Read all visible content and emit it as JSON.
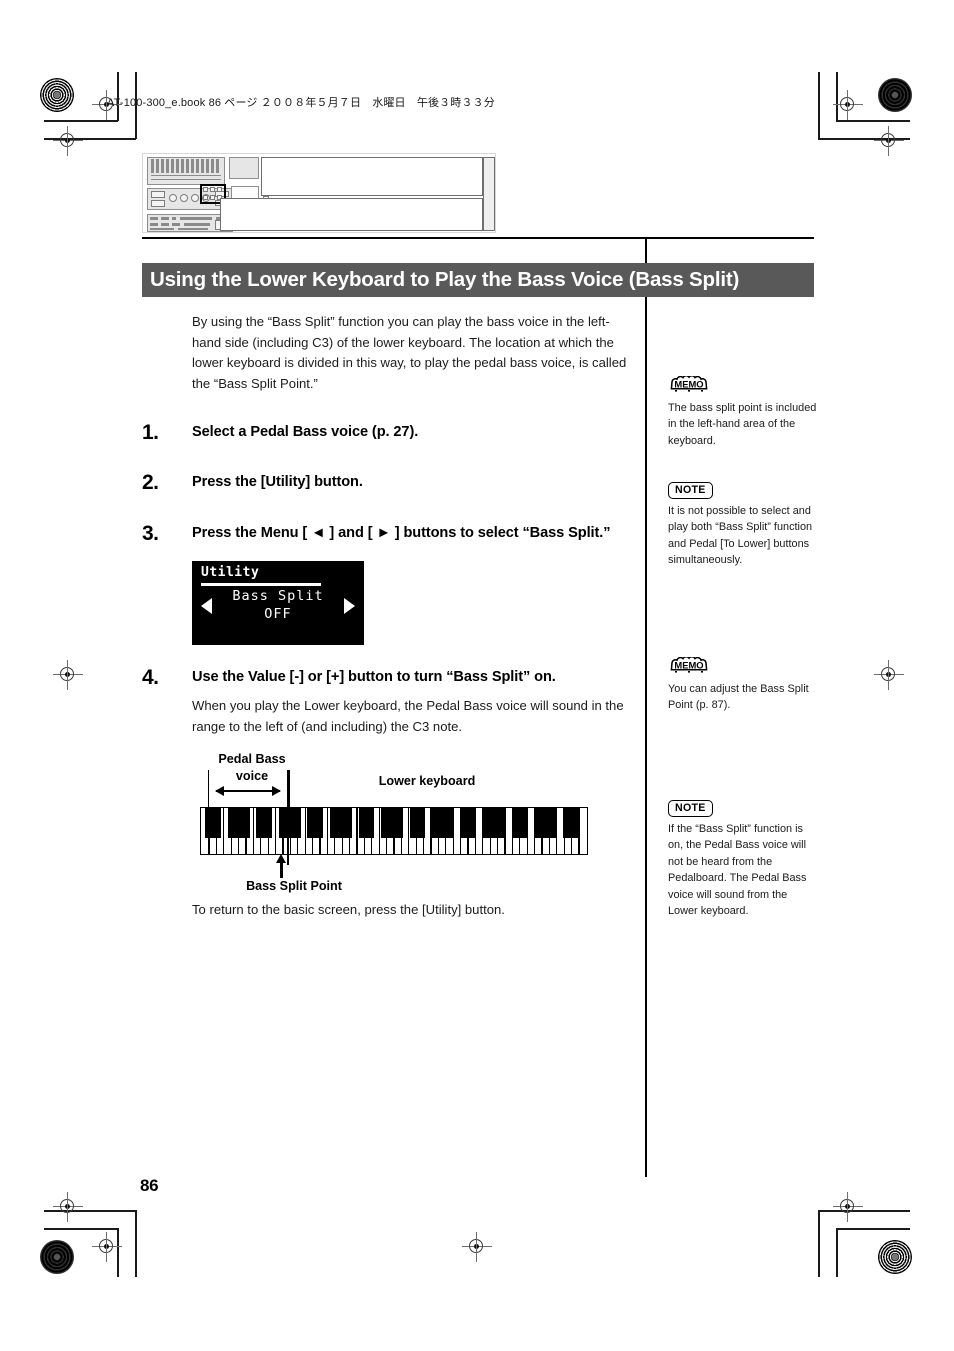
{
  "document": {
    "file_header": "AT-100-300_e.book  86 ページ  ２００８年５月７日　水曜日　午後３時３３分",
    "page_number": "86"
  },
  "section": {
    "title": "Using the Lower Keyboard to Play the Bass Voice (Bass Split)",
    "banner_color": "#595959",
    "intro": "By using the “Bass Split” function you can play the bass voice in the left-hand side (including C3) of the lower keyboard. The location at which the lower keyboard is divided in this way, to play the pedal bass voice, is called the “Bass Split Point.”"
  },
  "steps": [
    {
      "num": "1.",
      "text": "Select a Pedal Bass voice (p. 27)."
    },
    {
      "num": "2.",
      "text": "Press the [Utility] button."
    },
    {
      "num": "3.",
      "text": "Press the Menu [ ◄ ] and [ ► ] buttons to select “Bass Split.”"
    },
    {
      "num": "4.",
      "text": "Use the Value [-] or [+] button to turn “Bass Split” on.",
      "sub": "When you play the Lower keyboard, the Pedal Bass voice will sound in the range to the left of (and including) the C3 note."
    }
  ],
  "lcd": {
    "title": "Utility",
    "line1": "Bass Split",
    "line2": "OFF",
    "arrow_left": "left-triangle",
    "arrow_right": "right-triangle"
  },
  "diagram": {
    "label_pedal_bass_line1": "Pedal Bass",
    "label_pedal_bass_line2": "voice",
    "label_lower_keyboard": "Lower keyboard",
    "label_split_point": "Bass Split Point"
  },
  "closing_text": "To return to the basic screen, press the [Utility] button.",
  "sidebar": [
    {
      "type": "MEMO",
      "badge": "MEMO",
      "text": "The bass split point is included in the left-hand area of the keyboard."
    },
    {
      "type": "NOTE",
      "badge": "NOTE",
      "text": "It is not possible to select and play both “Bass Split” function and Pedal [To Lower] buttons simultaneously."
    },
    {
      "type": "MEMO",
      "badge": "MEMO",
      "text": "You can adjust the Bass Split Point (p. 87)."
    },
    {
      "type": "NOTE",
      "badge": "NOTE",
      "text": "If the “Bass Split” function is on, the Pedal Bass voice will not be heard from the Pedalboard. The Pedal Bass voice will sound from the Lower keyboard."
    }
  ]
}
